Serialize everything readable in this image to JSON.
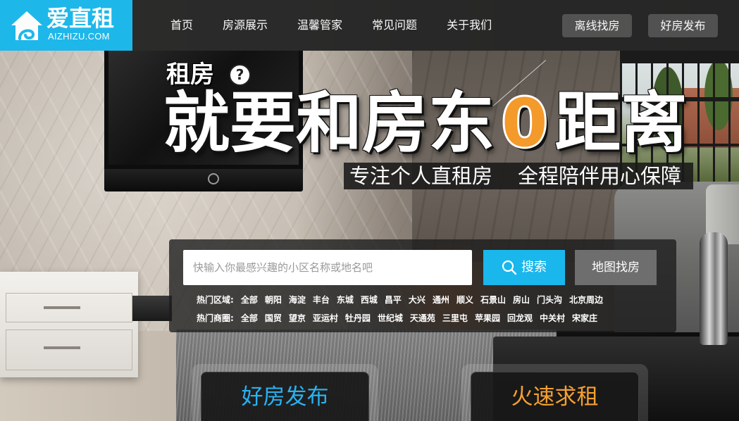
{
  "header": {
    "logo": {
      "icon": "house-swirl-icon",
      "name": "爱直租",
      "domain": "AIZHIZU.COM"
    },
    "nav": [
      {
        "label": "首页"
      },
      {
        "label": "房源展示"
      },
      {
        "label": "温馨管家"
      },
      {
        "label": "常见问题"
      },
      {
        "label": "关于我们"
      }
    ],
    "actions": {
      "offline_search": "离线找房",
      "publish": "好房发布"
    }
  },
  "hero": {
    "kicker": "租房",
    "kicker_badge": "?",
    "headline": {
      "before": "就要和房东",
      "zero": "0",
      "after": "距离"
    },
    "tagline": [
      "专注个人直租房",
      "全程陪伴用心保障"
    ]
  },
  "search": {
    "input": {
      "value": "",
      "placeholder": "快输入你最感兴趣的小区名称或地名吧"
    },
    "search_button": {
      "icon": "search-icon",
      "label": "搜索"
    },
    "map_button": "地图找房",
    "hot_areas": {
      "label": "热门区域:",
      "items": [
        "全部",
        "朝阳",
        "海淀",
        "丰台",
        "东城",
        "西城",
        "昌平",
        "大兴",
        "通州",
        "顺义",
        "石景山",
        "房山",
        "门头沟",
        "北京周边"
      ]
    },
    "hot_districts": {
      "label": "热门商圈:",
      "items": [
        "全部",
        "国贸",
        "望京",
        "亚运村",
        "牡丹园",
        "世纪城",
        "天通苑",
        "三里屯",
        "苹果园",
        "回龙观",
        "中关村",
        "宋家庄"
      ]
    }
  },
  "cta": {
    "publish": "好房发布",
    "rent": "火速求租"
  },
  "colors": {
    "brand": "#19b7ec",
    "orange": "#f39a2b",
    "header": "#262626",
    "button_gray": "#525252",
    "map_button": "#6e6e6e",
    "publish_text": "#29b2f0",
    "rent_text": "#f6a031"
  }
}
